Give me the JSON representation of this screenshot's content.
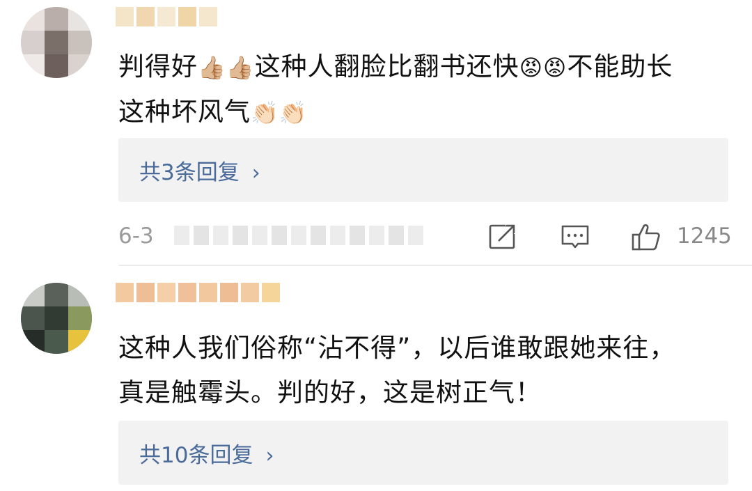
{
  "comments": [
    {
      "text_line1_a": "判得好",
      "emoji_thumbs": "👍🏼👍🏼",
      "text_line1_b": "这种人翻脸比翻书还快",
      "emoji_angry": "😡😡",
      "text_line1_c": "不能助长",
      "text_line2": "这种坏风气",
      "emoji_clap": "👏🏻👏🏻",
      "reply_label": "共3条回复",
      "date_prefix": "6-3",
      "like_count": "1245"
    },
    {
      "text_line1": "这种人我们俗称“沾不得”，以后谁敢跟她来往，",
      "text_line2": "真是触霉头。判的好，这是树正气！",
      "reply_label": "共10条回复"
    }
  ],
  "colors": {
    "link": "#4a6b9a",
    "meta_gray": "#9a9a9a",
    "reply_bg": "#f2f2f2"
  },
  "icons": {
    "share": "share-icon",
    "comment": "comment-icon",
    "like": "thumbs-up-icon",
    "chevron": "chevron-right-icon"
  },
  "chevron_glyph": "›"
}
